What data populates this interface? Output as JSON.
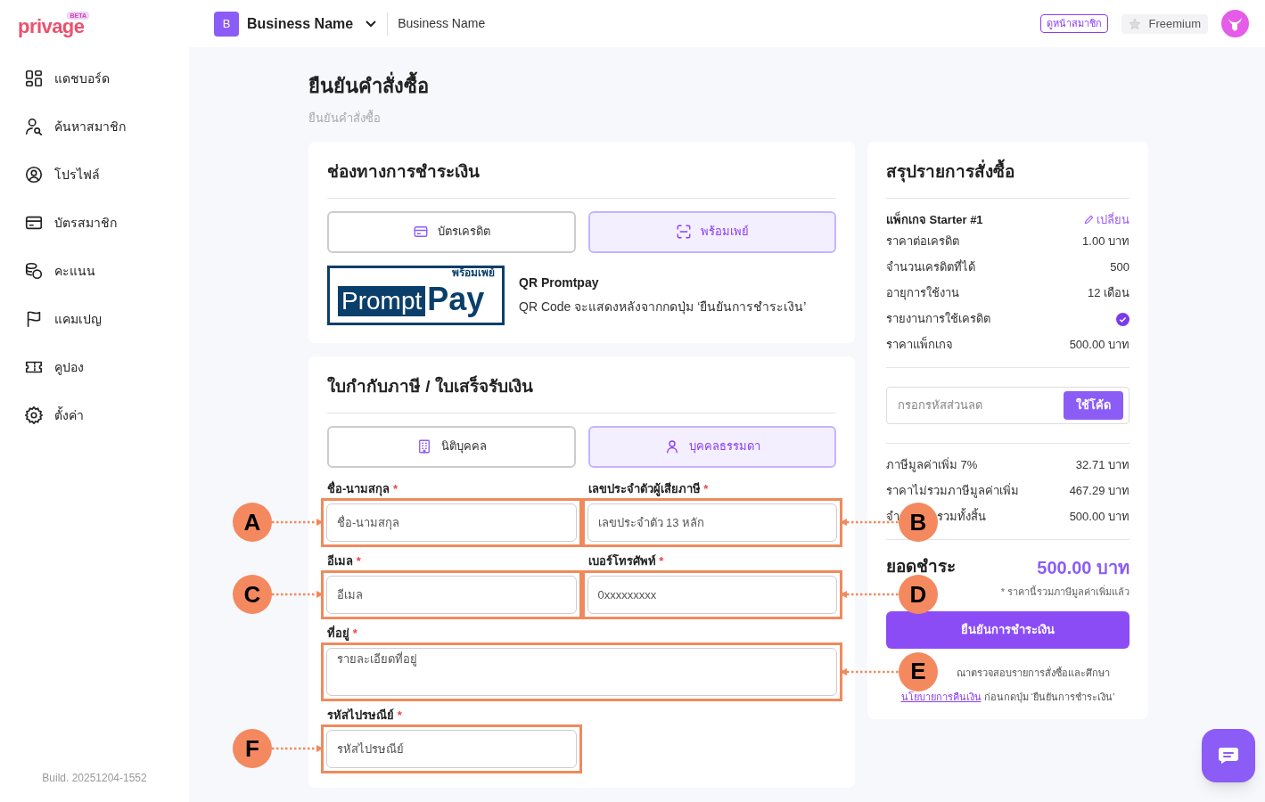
{
  "header": {
    "logo": {
      "word": "privage",
      "badge": "BETA"
    },
    "business": {
      "initial": "B",
      "name": "Business Name",
      "subtitle": "Business Name"
    },
    "member_page_button": "ดูหน้าสมาชิก",
    "plan": "Freemium"
  },
  "sidebar": {
    "items": [
      {
        "label": "แดชบอร์ด"
      },
      {
        "label": "ค้นหาสมาชิก"
      },
      {
        "label": "โปรไฟล์"
      },
      {
        "label": "บัตรสมาชิก"
      },
      {
        "label": "คะแนน"
      },
      {
        "label": "แคมเปญ"
      },
      {
        "label": "คูปอง"
      },
      {
        "label": "ตั้งค่า"
      }
    ],
    "build": "Build. 20251204-1552"
  },
  "page": {
    "title": "ยืนยันคำสั่งซื้อ",
    "breadcrumb": "ยืนยันคำสั่งซื้อ"
  },
  "payment": {
    "title": "ช่องทางการชำระเงิน",
    "options": [
      {
        "label": "บัตรเครดิต",
        "selected": false
      },
      {
        "label": "พร้อมเพย์",
        "selected": true
      }
    ],
    "promptpay_logo": {
      "thai": "พร้อมเพย์",
      "word_1": "Prompt",
      "word_2": "Pay"
    },
    "info_title": "QR Promtpay",
    "info_text": "QR Code จะแสดงหลังจากกดปุ่ม ‘ยืนยันการชำระเงิน’"
  },
  "invoice": {
    "title": "ใบกำกับภาษี / ใบเสร็จรับเงิน",
    "types": [
      {
        "label": "นิติบุคคล",
        "selected": false
      },
      {
        "label": "บุคคลธรรมดา",
        "selected": true
      }
    ],
    "fields": [
      {
        "kind": "input",
        "label": "ชื่อ-นามสกุล",
        "required_mark": "*",
        "placeholder": "ชื่อ-นามสกุล",
        "annotation": "A"
      },
      {
        "kind": "input",
        "label": "เลขประจำตัวผู้เสียภาษี",
        "required_mark": "*",
        "placeholder": "เลขประจำตัว 13 หลัก",
        "annotation": "B"
      },
      {
        "kind": "input",
        "label": "อีเมล",
        "required_mark": "*",
        "placeholder": "อีเมล",
        "annotation": "C"
      },
      {
        "kind": "input",
        "label": "เบอร์โทรศัพท์",
        "required_mark": "*",
        "placeholder": "0xxxxxxxxx",
        "annotation": "D"
      },
      {
        "kind": "textarea",
        "label": "ที่อยู่",
        "required_mark": "*",
        "placeholder": "รายละเอียดที่อยู่",
        "annotation": "E"
      },
      {
        "kind": "input",
        "label": "รหัสไปรษณีย์",
        "required_mark": "*",
        "placeholder": "รหัสไปรษณีย์",
        "annotation": "F"
      }
    ]
  },
  "summary": {
    "title": "สรุปรายการสั่งซื้อ",
    "package": "แพ็กเกจ Starter #1",
    "change_link": "เปลี่ยน",
    "rows": [
      {
        "kind": "text",
        "label": "ราคาต่อเครดิต",
        "value": "1.00 บาท"
      },
      {
        "kind": "text",
        "label": "จำนวนเครดิตที่ได้",
        "value": "500"
      },
      {
        "kind": "text",
        "label": "อายุการใช้งาน",
        "value": "12 เดือน"
      },
      {
        "kind": "check",
        "label": "รายงานการใช้เครดิต"
      },
      {
        "kind": "text",
        "label": "ราคาแพ็กเกจ",
        "value": "500.00 บาท"
      }
    ],
    "coupon": {
      "placeholder": "กรอกรหัสส่วนลด",
      "button": "ใช้โค้ด"
    },
    "tax_rows": [
      {
        "label_parts": [
          "ภาษีมูลค่าเพิ่ม 7%"
        ],
        "value": "32.71 บาท"
      },
      {
        "label_parts": [
          "ราคาไม่รวมภาษีมูลค่าเพิ่ม"
        ],
        "value": "467.29 บาท"
      },
      {
        "label_parts": [
          "จำ",
          "รวมทั้งสิ้น"
        ],
        "value": "500.00 บาท"
      }
    ],
    "total_label": "ยอดชำระ",
    "total_amount": "500.00 บาท",
    "total_note": "* ราคานี้รวมภาษีมูลค่าเพิ่มแล้ว",
    "confirm_button": "ยืนยันการชำระเงิน",
    "footnote": {
      "text_1": "ณาตรวจสอบรายการสั่งซื้อและศึกษา",
      "link": "นโยบายการคืนเงิน",
      "text_2": "ก่อนกดปุ่ม ‘ยืนยันการชำระเงิน’"
    }
  }
}
